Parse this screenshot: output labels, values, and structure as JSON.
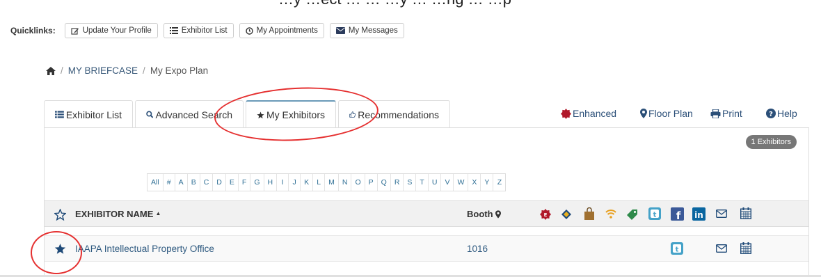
{
  "top_text": "…y …ect … … …y … …ng …  …p",
  "quicklinks": {
    "label": "Quicklinks:",
    "buttons": [
      {
        "label": "Update Your Profile",
        "icon": "edit-icon"
      },
      {
        "label": "Exhibitor List",
        "icon": "list-icon"
      },
      {
        "label": "My Appointments",
        "icon": "clock-icon"
      },
      {
        "label": "My Messages",
        "icon": "envelope-icon"
      }
    ]
  },
  "breadcrumb": {
    "home_icon": "home-icon",
    "separator": "/",
    "items": [
      "MY BRIEFCASE",
      "My Expo Plan"
    ]
  },
  "tabs": [
    {
      "label": "Exhibitor List",
      "icon": "list-icon",
      "active": false
    },
    {
      "label": "Advanced Search",
      "icon": "search-icon",
      "active": false
    },
    {
      "label": "My Exhibitors",
      "icon": "star-icon",
      "active": true
    },
    {
      "label": "Recommendations",
      "icon": "thumbs-up-icon",
      "active": false
    }
  ],
  "right_links": [
    {
      "label": "Enhanced",
      "icon": "enhanced-badge-icon"
    },
    {
      "label": "Floor Plan",
      "icon": "map-marker-icon"
    },
    {
      "label": "Print",
      "icon": "print-icon"
    },
    {
      "label": "Help",
      "icon": "question-circle-icon"
    }
  ],
  "count_badge": "1 Exhibitors",
  "alphabet": [
    "All",
    "#",
    "A",
    "B",
    "C",
    "D",
    "E",
    "F",
    "G",
    "H",
    "I",
    "J",
    "K",
    "L",
    "M",
    "N",
    "O",
    "P",
    "Q",
    "R",
    "S",
    "T",
    "U",
    "V",
    "W",
    "X",
    "Y",
    "Z"
  ],
  "table": {
    "header": {
      "name": "EXHIBITOR NAME",
      "sort_indicator": "▲",
      "booth": "Booth",
      "icons": [
        "star-outline-icon",
        "enhanced-badge-icon",
        "featured-product-icon",
        "shopping-bag-icon",
        "wifi-icon",
        "sponsor-tag-icon",
        "twitter-icon",
        "facebook-icon",
        "linkedin-icon",
        "envelope-icon",
        "calendar-icon"
      ]
    },
    "rows": [
      {
        "name": "IAAPA Intellectual Property Office",
        "booth": "1016",
        "favorited": true,
        "has_twitter": true
      }
    ]
  },
  "colors": {
    "link": "#2f5a80",
    "annotation": "#e53030",
    "enhanced_badge": "#b0182a",
    "twitter": "#45a2c8",
    "facebook": "#3b5998",
    "linkedin": "#0a66a0",
    "star": "#1f4a78",
    "count_badge": "#777777"
  }
}
